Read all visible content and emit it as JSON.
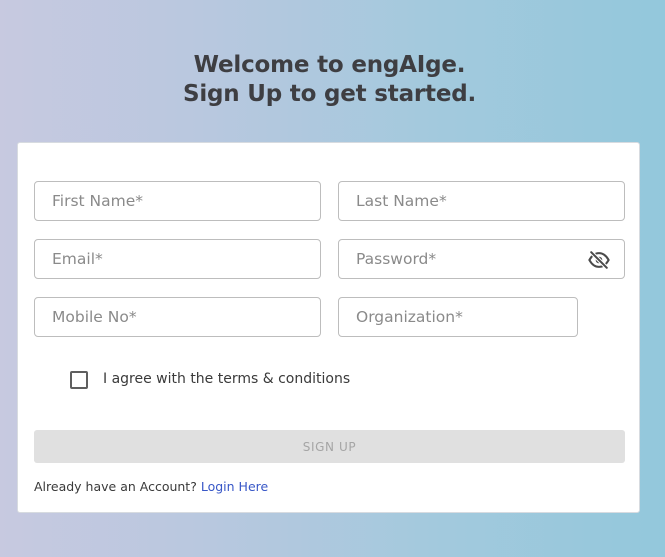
{
  "header": {
    "line1": "Welcome to engAIge.",
    "line2": "Sign Up to get started."
  },
  "form": {
    "first_name_placeholder": "First Name*",
    "last_name_placeholder": "Last Name*",
    "email_placeholder": "Email*",
    "password_placeholder": "Password*",
    "mobile_placeholder": "Mobile No*",
    "organization_placeholder": "Organization*",
    "password_toggle_icon": "eye-off-icon",
    "terms_label": "I agree with the terms & conditions",
    "terms_checked": false,
    "signup_label": "SIGN UP"
  },
  "footer": {
    "prompt": "Already have an Account?",
    "login_link": "Login Here"
  }
}
